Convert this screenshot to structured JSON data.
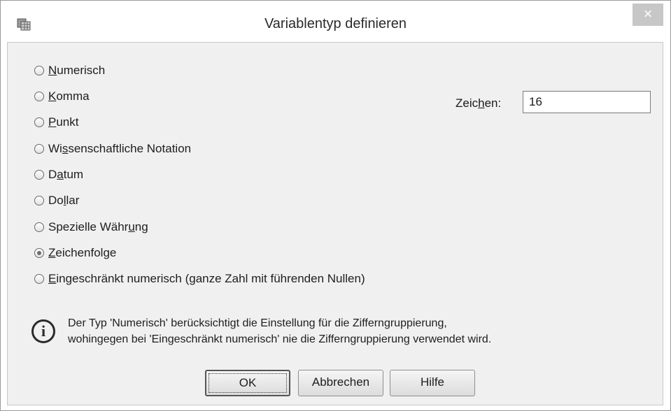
{
  "window": {
    "title": "Variablentyp definieren",
    "close_label": "×"
  },
  "radio_options": [
    {
      "pre": "",
      "u": "N",
      "post": "umerisch",
      "selected": false
    },
    {
      "pre": "",
      "u": "K",
      "post": "omma",
      "selected": false
    },
    {
      "pre": "",
      "u": "P",
      "post": "unkt",
      "selected": false
    },
    {
      "pre": "Wi",
      "u": "s",
      "post": "senschaftliche Notation",
      "selected": false
    },
    {
      "pre": "D",
      "u": "a",
      "post": "tum",
      "selected": false
    },
    {
      "pre": "Do",
      "u": "l",
      "post": "lar",
      "selected": false
    },
    {
      "pre": "Spezielle Währ",
      "u": "u",
      "post": "ng",
      "selected": false
    },
    {
      "pre": "",
      "u": "Z",
      "post": "eichenfolge",
      "selected": true
    },
    {
      "pre": "",
      "u": "E",
      "post": "ingeschränkt numerisch (ganze Zahl mit führenden Nullen)",
      "selected": false
    }
  ],
  "characters": {
    "label_pre": "Zeic",
    "label_u": "h",
    "label_post": "en:",
    "value": "16"
  },
  "info": {
    "icon": "info-icon",
    "line1": "Der Typ 'Numerisch' berücksichtigt die Einstellung für die Zifferngruppierung,",
    "line2": "wohingegen bei 'Eingeschränkt numerisch' nie die Zifferngruppierung verwendet wird."
  },
  "buttons": {
    "ok": "OK",
    "cancel": "Abbrechen",
    "help": "Hilfe"
  }
}
